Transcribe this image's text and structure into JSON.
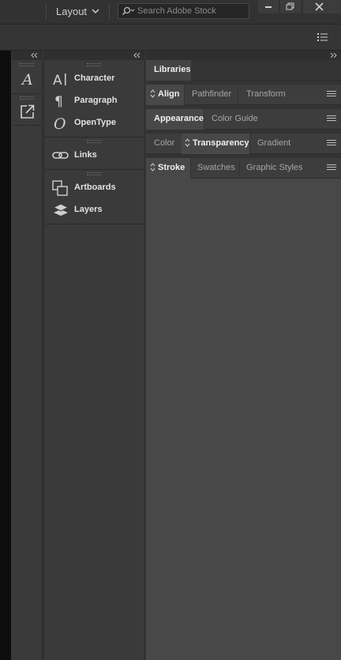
{
  "titlebar": {
    "workspace_label": "Layout",
    "search_placeholder": "Search Adobe Stock"
  },
  "panel_list": {
    "groups": [
      [
        {
          "label": "Character",
          "icon": "character-icon"
        },
        {
          "label": "Paragraph",
          "icon": "paragraph-icon"
        },
        {
          "label": "OpenType",
          "icon": "opentype-icon"
        }
      ],
      [
        {
          "label": "Links",
          "icon": "links-icon"
        }
      ],
      [
        {
          "label": "Artboards",
          "icon": "artboards-icon"
        },
        {
          "label": "Layers",
          "icon": "layers-icon"
        }
      ]
    ]
  },
  "right_panels": {
    "rows": [
      {
        "tabs": [
          {
            "label": "Libraries",
            "active": true
          }
        ],
        "menu": false
      },
      {
        "tabs": [
          {
            "label": "Align",
            "active": true,
            "arrows": true
          },
          {
            "label": "Pathfinder"
          },
          {
            "label": "Transform"
          }
        ],
        "menu": true
      },
      {
        "tabs": [
          {
            "label": "Appearance",
            "active": true
          },
          {
            "label": "Color Guide"
          }
        ],
        "menu": true
      },
      {
        "tabs": [
          {
            "label": "Color"
          },
          {
            "label": "Transparency",
            "active": true,
            "arrows": true
          },
          {
            "label": "Gradient"
          }
        ],
        "menu": true
      },
      {
        "tabs": [
          {
            "label": "Stroke",
            "active": true,
            "arrows": true
          },
          {
            "label": "Swatches"
          },
          {
            "label": "Graphic Styles"
          }
        ],
        "menu": true
      }
    ]
  }
}
